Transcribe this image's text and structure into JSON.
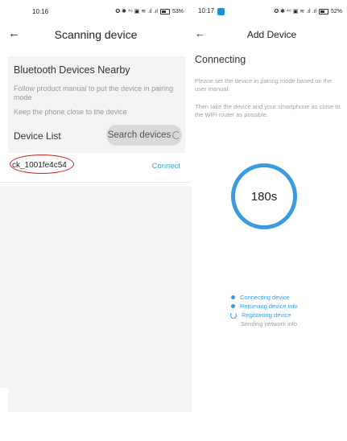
{
  "left": {
    "status": {
      "time": "10:16",
      "icons": "✪ ✱ ⁴⁶ ▣ ≋ .ıl .ıl",
      "battery": "53%"
    },
    "header": {
      "title": "Scanning device"
    },
    "bluetooth": {
      "title": "Bluetooth Devices Nearby",
      "hint_1": "Follow product manual to put the device in pairing mode",
      "hint_2": "Keep the phone close to the device"
    },
    "device_list": {
      "label": "Device List",
      "search_label": "Search devices",
      "devices": [
        {
          "name": "ck_1001fe4c54",
          "action": "Connect"
        }
      ]
    }
  },
  "right": {
    "status": {
      "time": "10:17",
      "icons": "✪ ✱ ⁴⁶ ▣ ≋ .ıl .ıl",
      "battery": "52%"
    },
    "header": {
      "title": "Add Device"
    },
    "connecting": {
      "title": "Connecting",
      "desc_1": "Please set the device in pairing mode based on the user manual.",
      "desc_2": "Then take the device and your smartphone as close to the WiFi router as possible.",
      "timer": "180s"
    },
    "steps": [
      {
        "label": "Connecting device",
        "state": "done"
      },
      {
        "label": "Retrieving device info",
        "state": "done"
      },
      {
        "label": "Registering device",
        "state": "in-progress"
      },
      {
        "label": "Sending network info",
        "state": "pending"
      }
    ]
  },
  "colors": {
    "accent": "#3a9be0",
    "link": "#33a4e0",
    "highlight": "#c81e1e"
  }
}
